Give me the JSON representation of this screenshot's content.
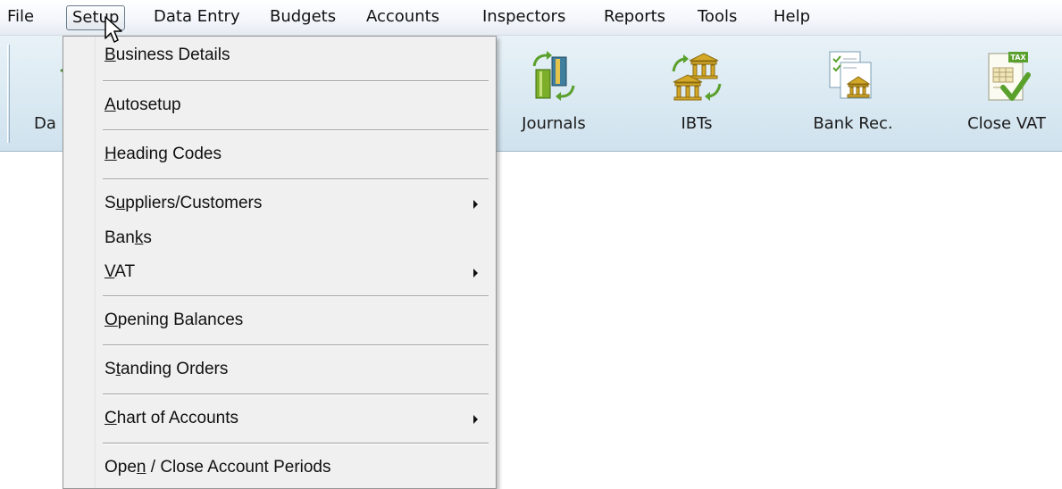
{
  "menubar": {
    "items": [
      "File",
      "Setup",
      "Data Entry",
      "Budgets",
      "Accounts",
      "Inspectors",
      "Reports",
      "Tools",
      "Help"
    ],
    "active": "Setup"
  },
  "toolbar": {
    "partial_left_label": "Da",
    "buttons": [
      {
        "label": "Journals",
        "icon": "journals-icon"
      },
      {
        "label": "IBTs",
        "icon": "ibts-icon"
      },
      {
        "label": "Bank Rec.",
        "icon": "bank-rec-icon"
      },
      {
        "label": "Close VAT",
        "icon": "close-vat-icon"
      }
    ],
    "tax_badge": "TAX"
  },
  "setup_menu": {
    "items": [
      {
        "label": "Business Details",
        "mnemonic": "B",
        "submenu": false
      },
      {
        "label": "Autosetup",
        "mnemonic": "A",
        "submenu": false
      },
      {
        "label": "Heading Codes",
        "mnemonic": "H",
        "submenu": false
      },
      {
        "label": "Suppliers/Customers",
        "mnemonic": "u",
        "submenu": true
      },
      {
        "label": "Banks",
        "mnemonic": "k",
        "submenu": false
      },
      {
        "label": "VAT",
        "mnemonic": "V",
        "submenu": true
      },
      {
        "label": "Opening Balances",
        "mnemonic": "O",
        "submenu": false
      },
      {
        "label": "Standing Orders",
        "mnemonic": "t",
        "submenu": false
      },
      {
        "label": "Chart of Accounts",
        "mnemonic": "C",
        "submenu": true
      },
      {
        "label": "Open / Close Account Periods",
        "mnemonic": "n",
        "submenu": false
      }
    ]
  },
  "colors": {
    "toolbar_top": "#e8f2f7",
    "toolbar_bottom": "#cfe2ee",
    "menu_bg": "#f0f0f0",
    "icon_green": "#5aa02c",
    "icon_gold": "#c9a227"
  }
}
